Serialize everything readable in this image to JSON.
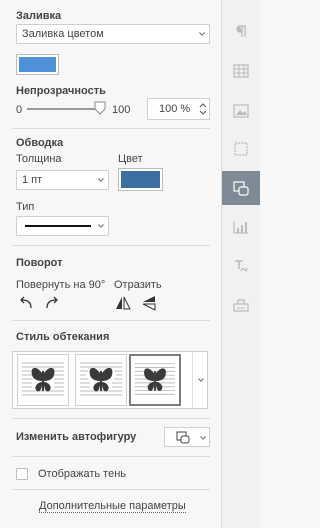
{
  "fill": {
    "heading": "Заливка",
    "type_value": "Заливка цветом",
    "color": "#4f90d6"
  },
  "opacity": {
    "heading": "Непрозрачность",
    "min_label": "0",
    "max_label": "100",
    "value_text": "100 %",
    "level_percent": 100
  },
  "stroke": {
    "heading": "Обводка",
    "size_label": "Толщина",
    "size_value": "1 пт",
    "color_label": "Цвет",
    "color": "#3d6fa0",
    "type_label": "Тип"
  },
  "rotation": {
    "heading": "Поворот",
    "rotate_label": "Повернуть на 90°",
    "flip_label": "Отразить"
  },
  "wrap": {
    "heading": "Стиль обтекания"
  },
  "change_shape": {
    "label": "Изменить автофигуру"
  },
  "shadow": {
    "label": "Отображать тень",
    "checked": false
  },
  "advanced": {
    "label": "Дополнительные параметры"
  },
  "rail": {
    "items": [
      "paragraph-icon",
      "table-icon",
      "image-icon",
      "header-footer-icon",
      "shape-icon",
      "chart-icon",
      "text-art-icon",
      "signature-icon"
    ],
    "active_index": 4
  },
  "colors": {
    "accent_active": "#7e8a96"
  }
}
